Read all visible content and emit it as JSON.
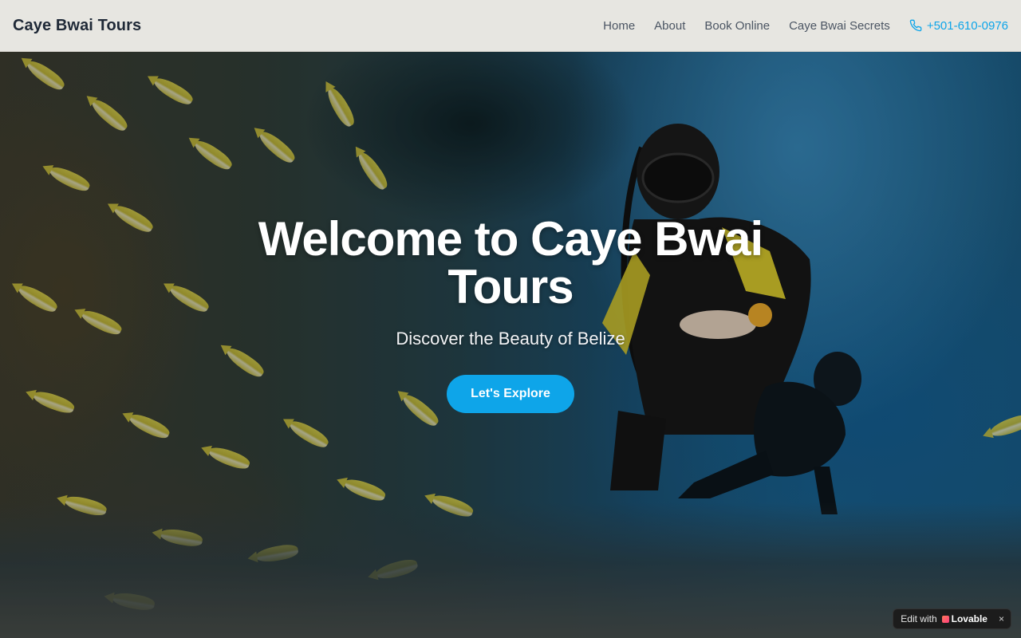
{
  "header": {
    "brand": "Caye Bwai Tours",
    "nav": [
      {
        "label": "Home"
      },
      {
        "label": "About"
      },
      {
        "label": "Book Online"
      },
      {
        "label": "Caye Bwai Secrets"
      }
    ],
    "phone": {
      "label": "+501-610-0976",
      "icon": "phone-icon"
    }
  },
  "hero": {
    "title": "Welcome to Caye Bwai Tours",
    "subtitle": "Discover the Beauty of Belize",
    "cta_label": "Let's Explore"
  },
  "badge": {
    "prefix": "Edit with",
    "brand": "Lovable",
    "close": "×"
  },
  "colors": {
    "accent": "#0ea5e9",
    "header_bg": "#eeece6",
    "brand_text": "#1f2937",
    "nav_text": "#4b5563"
  }
}
